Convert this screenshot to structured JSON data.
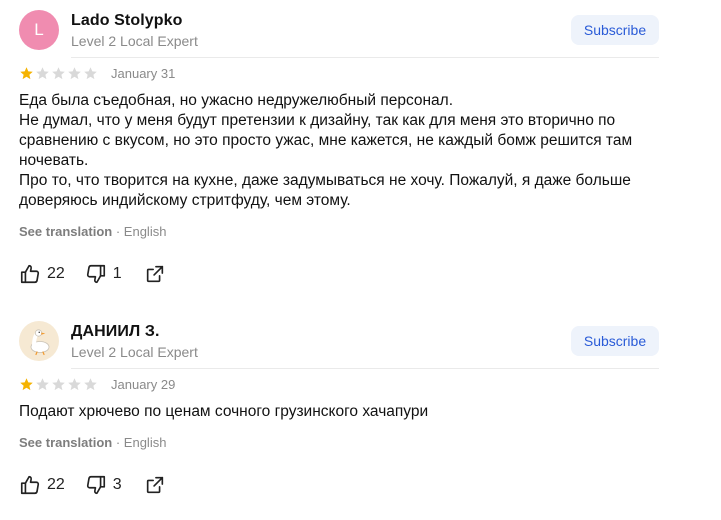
{
  "colors": {
    "star_filled": "#f5b301",
    "star_empty": "#d9d9d9",
    "subscribe_text": "#2a5bd7",
    "subscribe_bg": "#eef3fb",
    "avatar_letter_bg": "#f08cb0"
  },
  "reviews": [
    {
      "author": "Lado Stolypko",
      "avatar_letter": "L",
      "avatar_icon": "letter-avatar",
      "level": "Level 2 Local Expert",
      "subscribe_label": "Subscribe",
      "rating": 1,
      "date": "January 31",
      "text": [
        "Еда была съедобная, но ужасно недружелюбный персонал.",
        "Не думал, что у меня будут претензии к дизайну, так как для меня это вторично по сравнению с вкусом, но это просто ужас, мне кажется, не каждый бомж решится там ночевать.",
        "Про то, что творится на кухне, даже задумываться не хочу. Пожалуй, я даже больше доверяюсь индийскому стритфуду, чем этому."
      ],
      "see_translation": "See translation",
      "separator": "·",
      "language": "English",
      "likes": "22",
      "dislikes": "1"
    },
    {
      "author": "ДАНИИЛ З.",
      "avatar_icon": "goose-avatar",
      "level": "Level 2 Local Expert",
      "subscribe_label": "Subscribe",
      "rating": 1,
      "date": "January 29",
      "text": [
        "Подают хрючево по ценам сочного грузинского хачапури"
      ],
      "see_translation": "See translation",
      "separator": "·",
      "language": "English",
      "likes": "22",
      "dislikes": "3"
    }
  ]
}
